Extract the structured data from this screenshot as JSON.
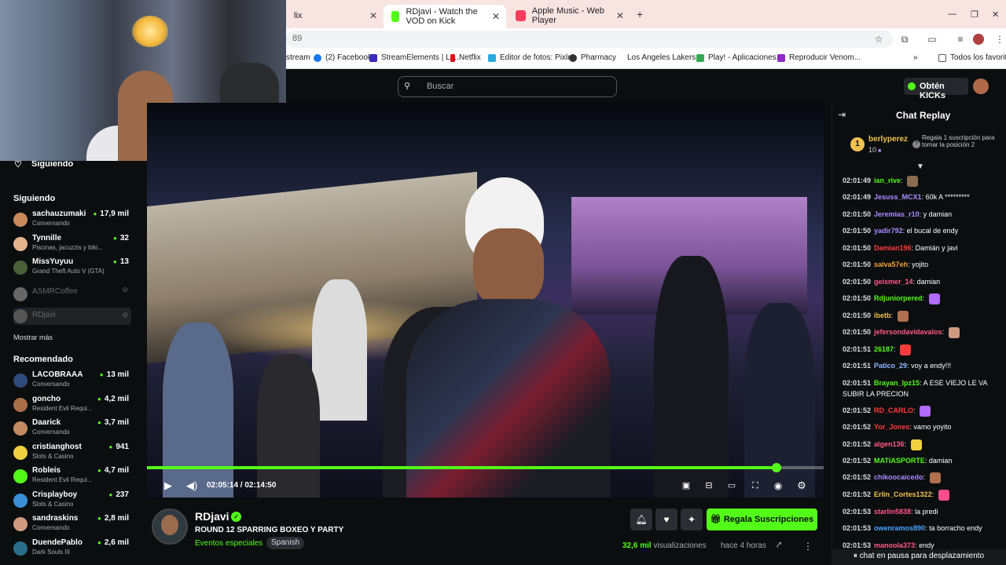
{
  "browser": {
    "tabs": [
      {
        "title": "lix",
        "active": false
      },
      {
        "title": "RDjavi - Watch the VOD on Kick",
        "active": true
      },
      {
        "title": "Apple Music - Web Player",
        "active": false
      }
    ],
    "url_fragment": "89",
    "bookmarks": [
      "stream",
      "(2) Facebook",
      "StreamElements | La...",
      "Netflix",
      "Editor de fotos: Pixlr...",
      "Pharmacy",
      "Los Angeles Lakers...",
      "Play! - Aplicaciones...",
      "Reproducir Venom..."
    ],
    "all_bookmarks": "Todos los favoritos"
  },
  "kick": {
    "search_placeholder": "Buscar",
    "get_kicks": "Obtén KICKs"
  },
  "sidebar": {
    "following_title": "Siguiendo",
    "following_section": "Siguiendo",
    "following": [
      {
        "name": "sachauzumaki",
        "sub": "Conversando",
        "viewers": "17,9 mil",
        "avatar": "#c98a5e"
      },
      {
        "name": "Tynnille",
        "sub": "Piscinas, jacuzzis y biki...",
        "viewers": "32",
        "avatar": "#e3b38e"
      },
      {
        "name": "MissYuyuu",
        "sub": "Grand Theft Auto V (GTA)",
        "viewers": "13",
        "avatar": "#4b5f3a"
      },
      {
        "name": "ASMRCoffee",
        "sub": "",
        "viewers": "",
        "avatar": "#777"
      },
      {
        "name": "RDjavi",
        "sub": "",
        "viewers": "",
        "avatar": "#555"
      }
    ],
    "show_more": "Mostrar más",
    "recommended_title": "Recomendado",
    "recommended": [
      {
        "name": "LACOBRAAA",
        "sub": "Conversando",
        "viewers": "13 mil",
        "avatar": "#2e4a7a"
      },
      {
        "name": "goncho",
        "sub": "Resident Evil Requi...",
        "viewers": "4,2 mil",
        "avatar": "#a87048"
      },
      {
        "name": "Daarick",
        "sub": "Conversando",
        "viewers": "3,7 mil",
        "avatar": "#c28a60"
      },
      {
        "name": "cristianghost",
        "sub": "Slots & Casino",
        "viewers": "941",
        "avatar": "#f0d040"
      },
      {
        "name": "Robleis",
        "sub": "Resident Evil Requi...",
        "viewers": "4,7 mil",
        "avatar": "#53fc18"
      },
      {
        "name": "Crisplayboy",
        "sub": "Slots & Casino",
        "viewers": "237",
        "avatar": "#3a8fd6"
      },
      {
        "name": "sandraskins",
        "sub": "Conversando",
        "viewers": "2,8 mil",
        "avatar": "#d09a80"
      },
      {
        "name": "DuendePablo",
        "sub": "Dark Souls III",
        "viewers": "2,6 mil",
        "avatar": "#2a6e8a"
      }
    ]
  },
  "player": {
    "time_current": "02:05:14",
    "time_total": "02:14:50",
    "timecode": "02:05:14 / 02:14:50",
    "progress": 0.93
  },
  "stream": {
    "streamer": "RDjavi",
    "title": "ROUND 12 SPARRING  BOXEO Y PARTY",
    "category": "Eventos especiales",
    "language": "Spanish",
    "subscribe_label": "Regala Suscripciones",
    "views_count": "32,6 mil",
    "views_label": "visualizaciones",
    "ago": "hace 4 horas"
  },
  "chat": {
    "title": "Chat Replay",
    "top_gifter": {
      "rank": "1",
      "name": "berlyperez",
      "count": "10"
    },
    "pin_prompt": "Regala 1 suscripción para tomar la posición 2",
    "paused_label": "chat en pausa para desplazamiento",
    "messages": [
      {
        "ts": "02:01:49",
        "user": "ian_rive",
        "color": "#53fc18",
        "text": "",
        "emote": "#8a6b50"
      },
      {
        "ts": "02:01:49",
        "user": "Jesuss_MCX1",
        "color": "#a98bff",
        "text": "60k A *********",
        "emote": ""
      },
      {
        "ts": "02:01:50",
        "user": "Jeremias_r10",
        "color": "#a98bff",
        "text": "y damian",
        "emote": ""
      },
      {
        "ts": "02:01:50",
        "user": "yadir792",
        "color": "#a98bff",
        "text": "el bucal de endy",
        "emote": ""
      },
      {
        "ts": "02:01:50",
        "user": "Damian196",
        "color": "#ff3b3b",
        "text": "Damián y javi",
        "emote": ""
      },
      {
        "ts": "02:01:50",
        "user": "salva57eh",
        "color": "#f2a33a",
        "text": "yojito",
        "emote": ""
      },
      {
        "ts": "02:01:50",
        "user": "geismer_14",
        "color": "#ff5a8a",
        "text": "damian",
        "emote": ""
      },
      {
        "ts": "02:01:50",
        "user": "Rdjuniorpered",
        "color": "#53fc18",
        "text": "",
        "emote": "#b26bff"
      },
      {
        "ts": "02:01:50",
        "user": "ibetb",
        "color": "#f2c14e",
        "text": "",
        "emote": "#b07050"
      },
      {
        "ts": "02:01:50",
        "user": "jefersondavidavalos",
        "color": "#ff5a8a",
        "text": "",
        "emote": "#d09a80"
      },
      {
        "ts": "02:01:51",
        "user": "26187",
        "color": "#53fc18",
        "text": "",
        "emote": "#ff3b3b"
      },
      {
        "ts": "02:01:51",
        "user": "Patico_29",
        "color": "#8fb8ff",
        "text": "voy a endy!!!",
        "emote": ""
      },
      {
        "ts": "02:01:51",
        "user": "Brayan_lpz15",
        "color": "#53fc18",
        "text": "A ESE VIEJO LE VA SUBIR LA PRECION",
        "emote": ""
      },
      {
        "ts": "02:01:52",
        "user": "RD_CARLO",
        "color": "#ff3b3b",
        "text": "",
        "emote": "#b26bff"
      },
      {
        "ts": "02:01:52",
        "user": "Yor_Jones",
        "color": "#ff3b3b",
        "text": "vamo yoyito",
        "emote": ""
      },
      {
        "ts": "02:01:52",
        "user": "algen136",
        "color": "#ff5a8a",
        "text": "",
        "emote": "#f0d040"
      },
      {
        "ts": "02:01:52",
        "user": "MATIASPORTE",
        "color": "#53fc18",
        "text": "damian",
        "emote": ""
      },
      {
        "ts": "02:01:52",
        "user": "chikoocaicedo",
        "color": "#a98bff",
        "text": "",
        "emote": "#b07050"
      },
      {
        "ts": "02:01:52",
        "user": "Erlin_Cortes1322",
        "color": "#f2c14e",
        "text": "",
        "emote": "#ff4d8d"
      },
      {
        "ts": "02:01:53",
        "user": "starlin5838",
        "color": "#ff5a8a",
        "text": "la predi",
        "emote": ""
      },
      {
        "ts": "02:01:53",
        "user": "owenramos890",
        "color": "#4aa3ff",
        "text": "ta borracho endy",
        "emote": ""
      },
      {
        "ts": "02:01:53",
        "user": "manoola373",
        "color": "#ff5a8a",
        "text": "endy",
        "emote": ""
      }
    ]
  }
}
